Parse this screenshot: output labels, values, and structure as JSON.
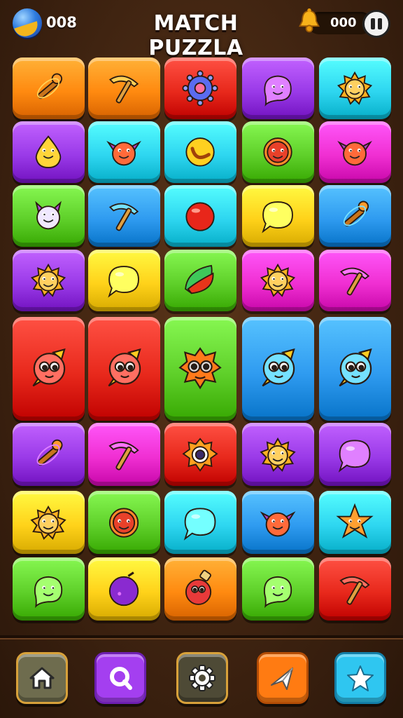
{
  "header": {
    "title": "MATCH PUZZLA",
    "gem_count": "008",
    "coin_count": "000",
    "gem_icon": "gem-icon",
    "bell_icon": "bell-icon",
    "pause_icon": "pause-icon"
  },
  "board": {
    "columns": 5,
    "rows": [
      [
        "orange:wand",
        "orange:pickaxe",
        "red:spiky-ball",
        "purple:blob",
        "cyan:sun-face"
      ],
      [
        "purple:drop-creature",
        "cyan:bat-creature",
        "cyan:crescent",
        "green:round-face",
        "magenta:bat-creature"
      ],
      [
        "green:cat-creature",
        "blue:pickaxe",
        "cyan:red-ball",
        "yellow:speech-bubble",
        "blue:wand"
      ],
      [
        "purple:sun-face",
        "yellow:speech-bubble",
        "green:leaf",
        "magenta:sun-face",
        "magenta:pickaxe"
      ],
      [
        "red:rocket-creature",
        "red:rocket-creature",
        "green:goggle-creature",
        "blue:rocket-creature",
        "blue:rocket-creature"
      ],
      [
        "purple:wand",
        "magenta:pickaxe",
        "red:eye-creature",
        "purple:sun-face",
        "purple:speech-bubble"
      ],
      [
        "yellow:sun-face",
        "green:round-face",
        "cyan:speech-bubble",
        "blue:bat-creature",
        "cyan:star-creature"
      ],
      [
        "green:blob",
        "yellow:plum",
        "orange:potion",
        "green:blob",
        "red:pickaxe"
      ]
    ]
  },
  "nav": [
    {
      "name": "home",
      "icon": "home-icon"
    },
    {
      "name": "search",
      "icon": "search-icon"
    },
    {
      "name": "settings",
      "icon": "gear-icon"
    },
    {
      "name": "message",
      "icon": "paper-plane-icon"
    },
    {
      "name": "favorites",
      "icon": "star-icon"
    }
  ],
  "colors": {
    "red": "#e8291c",
    "orange": "#ff8a10",
    "yellow": "#ffd21a",
    "green": "#5fd02a",
    "cyan": "#2ed6f0",
    "blue": "#2f9bf0",
    "purple": "#9a3ae8",
    "magenta": "#f02fd2"
  }
}
